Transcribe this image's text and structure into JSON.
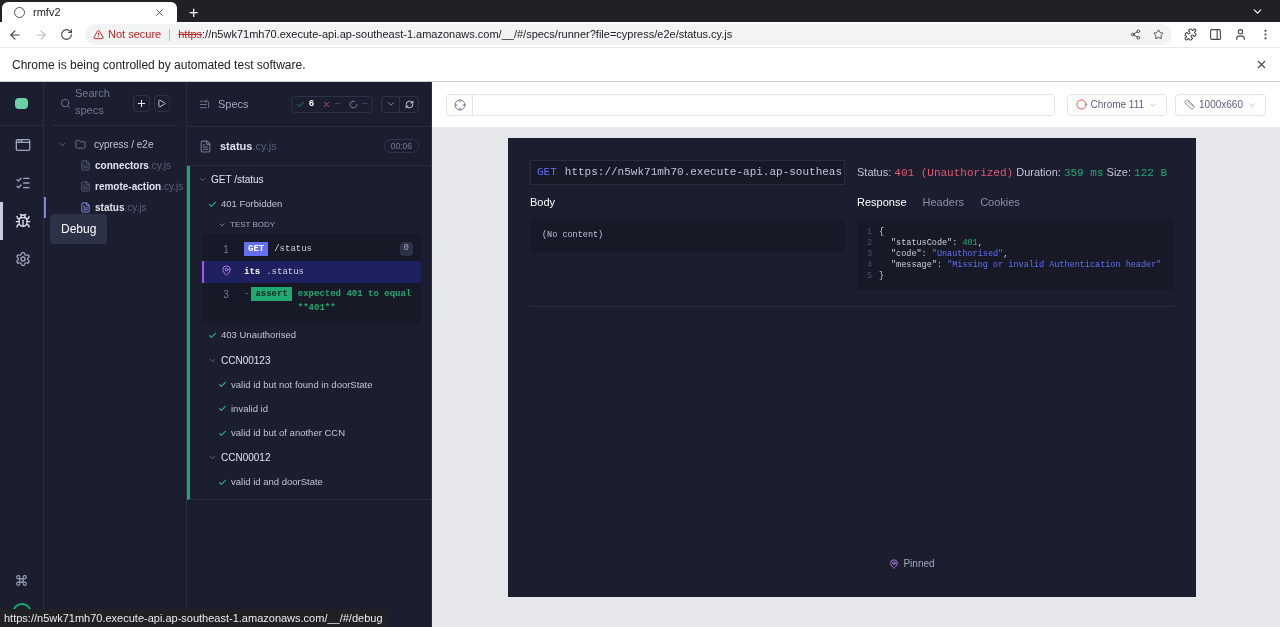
{
  "browser": {
    "tab_title": "rmfv2",
    "new_tab": "+",
    "not_secure": "Not secure",
    "url_scheme": "https",
    "url_rest": "://n5wk71mh70.execute-api.ap-southeast-1.amazonaws.com/__/#/specs/runner?file=cypress/e2e/status.cy.js"
  },
  "infobar": {
    "text": "Chrome is being controlled by automated test software."
  },
  "nav": [
    {
      "kind": "specs",
      "selected": false
    },
    {
      "kind": "runs",
      "selected": false
    },
    {
      "kind": "debug",
      "selected": true
    },
    {
      "kind": "settings",
      "selected": false
    }
  ],
  "tooltip": "Debug",
  "specs_panel": {
    "search_placeholder": "Search specs",
    "folder": {
      "name": "cypress / e2e",
      "expanded": true
    },
    "files": [
      {
        "name": "connectors",
        "ext": ".cy.js",
        "selected": false
      },
      {
        "name": "remote-action",
        "ext": ".cy.js",
        "selected": false
      },
      {
        "name": "status",
        "ext": ".cy.js",
        "selected": true
      }
    ]
  },
  "reporter": {
    "title": "Specs",
    "passed": "6",
    "failed": "--",
    "pending": "--",
    "spec_name": "status",
    "spec_ext": ".cy.js",
    "duration": "00:06",
    "tests": [
      {
        "kind": "suite",
        "title": "GET /status",
        "expanded": true,
        "children": [
          {
            "kind": "test",
            "title": "401 Forbidden",
            "passed": true,
            "body": {
              "title": "TEST BODY",
              "commands": [
                {
                  "kind": "request",
                  "number": "1",
                  "badge": "GET",
                  "message": "/status",
                  "count": "0",
                  "selected": false
                },
                {
                  "kind": "pinned",
                  "name": "its",
                  "message": ".status",
                  "selected": true
                },
                {
                  "kind": "assert",
                  "number": "3",
                  "prefix": "-",
                  "badge": "assert",
                  "message": "expected 401 to equal **401**",
                  "selected": false
                }
              ]
            }
          },
          {
            "kind": "test",
            "title": "403 Unauthorised",
            "passed": true
          },
          {
            "kind": "suite",
            "title": "CCN00123",
            "expanded": true,
            "children": [
              {
                "kind": "test",
                "title": "valid id but not found in doorState",
                "passed": true
              },
              {
                "kind": "test",
                "title": "invalid id",
                "passed": true
              },
              {
                "kind": "test",
                "title": "valid id but of another CCN",
                "passed": true
              }
            ]
          },
          {
            "kind": "suite",
            "title": "CCN00012",
            "expanded": true,
            "children": [
              {
                "kind": "test",
                "title": "valid id and doorState",
                "passed": true
              }
            ]
          }
        ]
      }
    ]
  },
  "toolbar": {
    "browser": "Chrome 111",
    "viewport": "1000x660"
  },
  "aut": {
    "method": "GET",
    "url": "https://n5wk71mh70.execute-api.ap-southeas",
    "status_label": "Status:",
    "status": "401 (Unauthorized)",
    "duration_label": "Duration:",
    "duration": "359 ms",
    "size_label": "Size:",
    "size": "122 B",
    "body_title": "Body",
    "body": "(No content)",
    "tabs": [
      {
        "label": "Response",
        "selected": true
      },
      {
        "label": "Headers",
        "selected": false
      },
      {
        "label": "Cookies",
        "selected": false
      }
    ],
    "response_lines": [
      {
        "number": "1",
        "tokens": [
          {
            "kind": "punct",
            "text": "{"
          }
        ]
      },
      {
        "number": "2",
        "tokens": [
          {
            "kind": "key",
            "text": "\"statusCode\""
          },
          {
            "kind": "punct",
            "text": ": "
          },
          {
            "kind": "number",
            "text": "401"
          },
          {
            "kind": "punct",
            "text": ","
          }
        ]
      },
      {
        "number": "3",
        "tokens": [
          {
            "kind": "key",
            "text": "\"code\""
          },
          {
            "kind": "punct",
            "text": ": "
          },
          {
            "kind": "string",
            "text": "\"Unauthorised\""
          },
          {
            "kind": "punct",
            "text": ","
          }
        ]
      },
      {
        "number": "4",
        "tokens": [
          {
            "kind": "key",
            "text": "\"message\""
          },
          {
            "kind": "punct",
            "text": ": "
          },
          {
            "kind": "string",
            "text": "\"Missing or invalid Authentication header\""
          }
        ]
      },
      {
        "number": "5",
        "tokens": [
          {
            "kind": "punct",
            "text": "}"
          }
        ]
      }
    ],
    "pinned": "Pinned"
  },
  "status_bubble": "https://n5wk71mh70.execute-api.ap-southeast-1.amazonaws.com/__/#/debug"
}
